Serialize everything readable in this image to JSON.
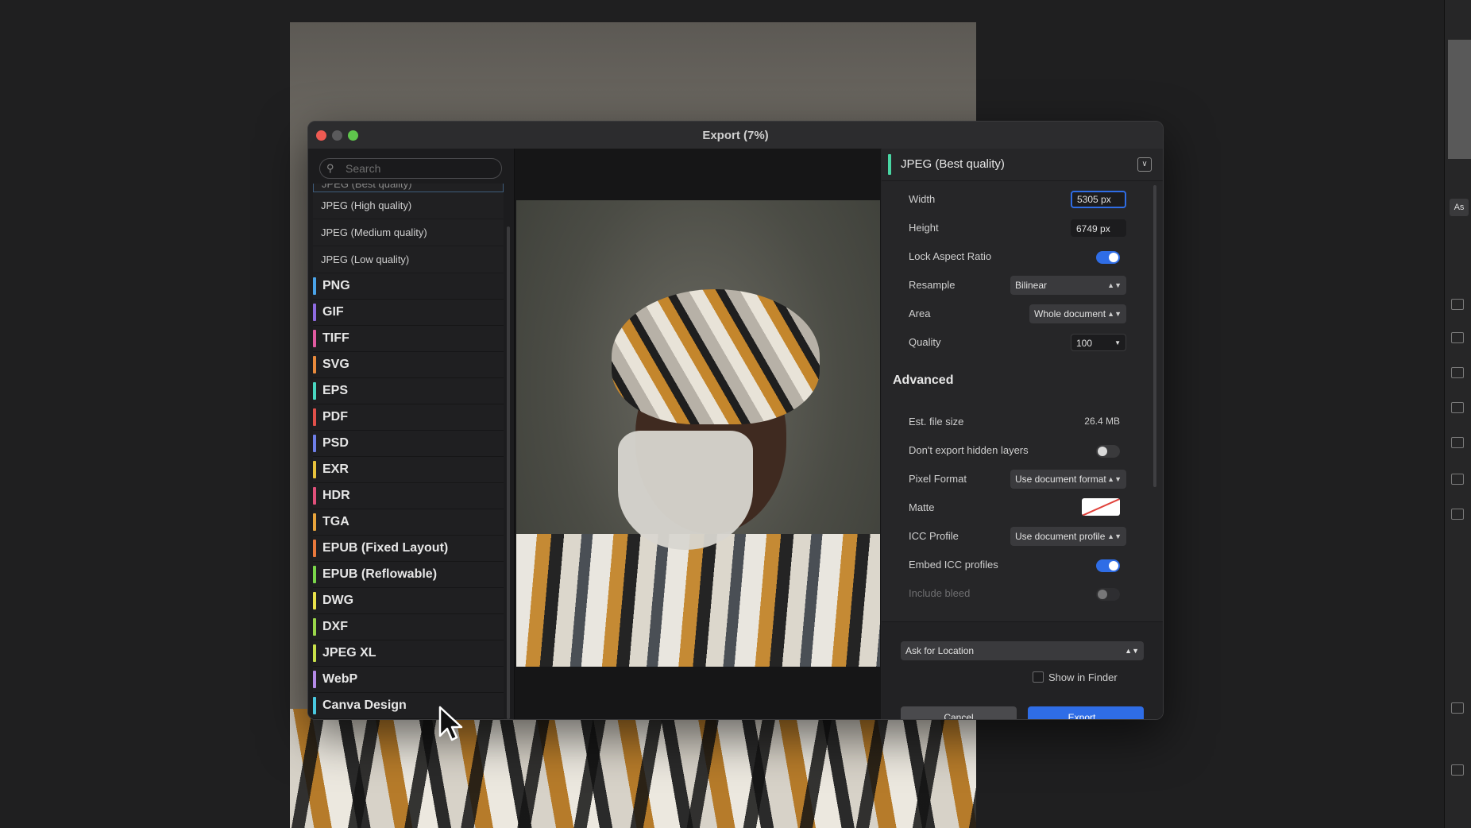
{
  "dialog": {
    "title": "Export (7%)"
  },
  "search": {
    "placeholder": "Search"
  },
  "presets": {
    "partial_label": "JPEG (Best quality)",
    "sub_items": [
      "JPEG (High quality)",
      "JPEG (Medium quality)",
      "JPEG (Low quality)"
    ],
    "formats": [
      {
        "label": "PNG",
        "color": "#4aa3e8"
      },
      {
        "label": "GIF",
        "color": "#8e6be0"
      },
      {
        "label": "TIFF",
        "color": "#e05aa0"
      },
      {
        "label": "SVG",
        "color": "#e88a3c"
      },
      {
        "label": "EPS",
        "color": "#49d6c0"
      },
      {
        "label": "PDF",
        "color": "#e0504a"
      },
      {
        "label": "PSD",
        "color": "#6e7fe8"
      },
      {
        "label": "EXR",
        "color": "#e8c23c"
      },
      {
        "label": "HDR",
        "color": "#e0507a"
      },
      {
        "label": "TGA",
        "color": "#e8a43c"
      },
      {
        "label": "EPUB (Fixed Layout)",
        "color": "#e8783c"
      },
      {
        "label": "EPUB (Reflowable)",
        "color": "#7ad64a"
      },
      {
        "label": "DWG",
        "color": "#e8e04a"
      },
      {
        "label": "DXF",
        "color": "#9ad64a"
      },
      {
        "label": "JPEG XL",
        "color": "#c8e04a"
      },
      {
        "label": "WebP",
        "color": "#b48ae8"
      },
      {
        "label": "Canva Design",
        "color": "#49c8e0"
      }
    ]
  },
  "settings": {
    "preset_name": "JPEG (Best quality)",
    "width": {
      "label": "Width",
      "value": "5305 px"
    },
    "height": {
      "label": "Height",
      "value": "6749 px"
    },
    "lock_aspect": {
      "label": "Lock Aspect Ratio",
      "on": true
    },
    "resample": {
      "label": "Resample",
      "value": "Bilinear"
    },
    "area": {
      "label": "Area",
      "value": "Whole document"
    },
    "quality": {
      "label": "Quality",
      "value": "100"
    },
    "advanced_title": "Advanced",
    "file_size": {
      "label": "Est. file size",
      "value": "26.4 MB"
    },
    "hidden_layers": {
      "label": "Don't export hidden layers",
      "on": false
    },
    "pixel_format": {
      "label": "Pixel Format",
      "value": "Use document format"
    },
    "matte": {
      "label": "Matte"
    },
    "icc_profile": {
      "label": "ICC Profile",
      "value": "Use document profile"
    },
    "embed_icc": {
      "label": "Embed ICC profiles",
      "on": true
    },
    "include_bleed": {
      "label": "Include bleed",
      "on": false
    },
    "location": "Ask for Location",
    "show_in_finder": "Show in Finder",
    "cancel": "Cancel",
    "export": "Export..."
  },
  "colors": {
    "accent": "#2f6de6",
    "jpeg_bar": "#49d6a3"
  }
}
